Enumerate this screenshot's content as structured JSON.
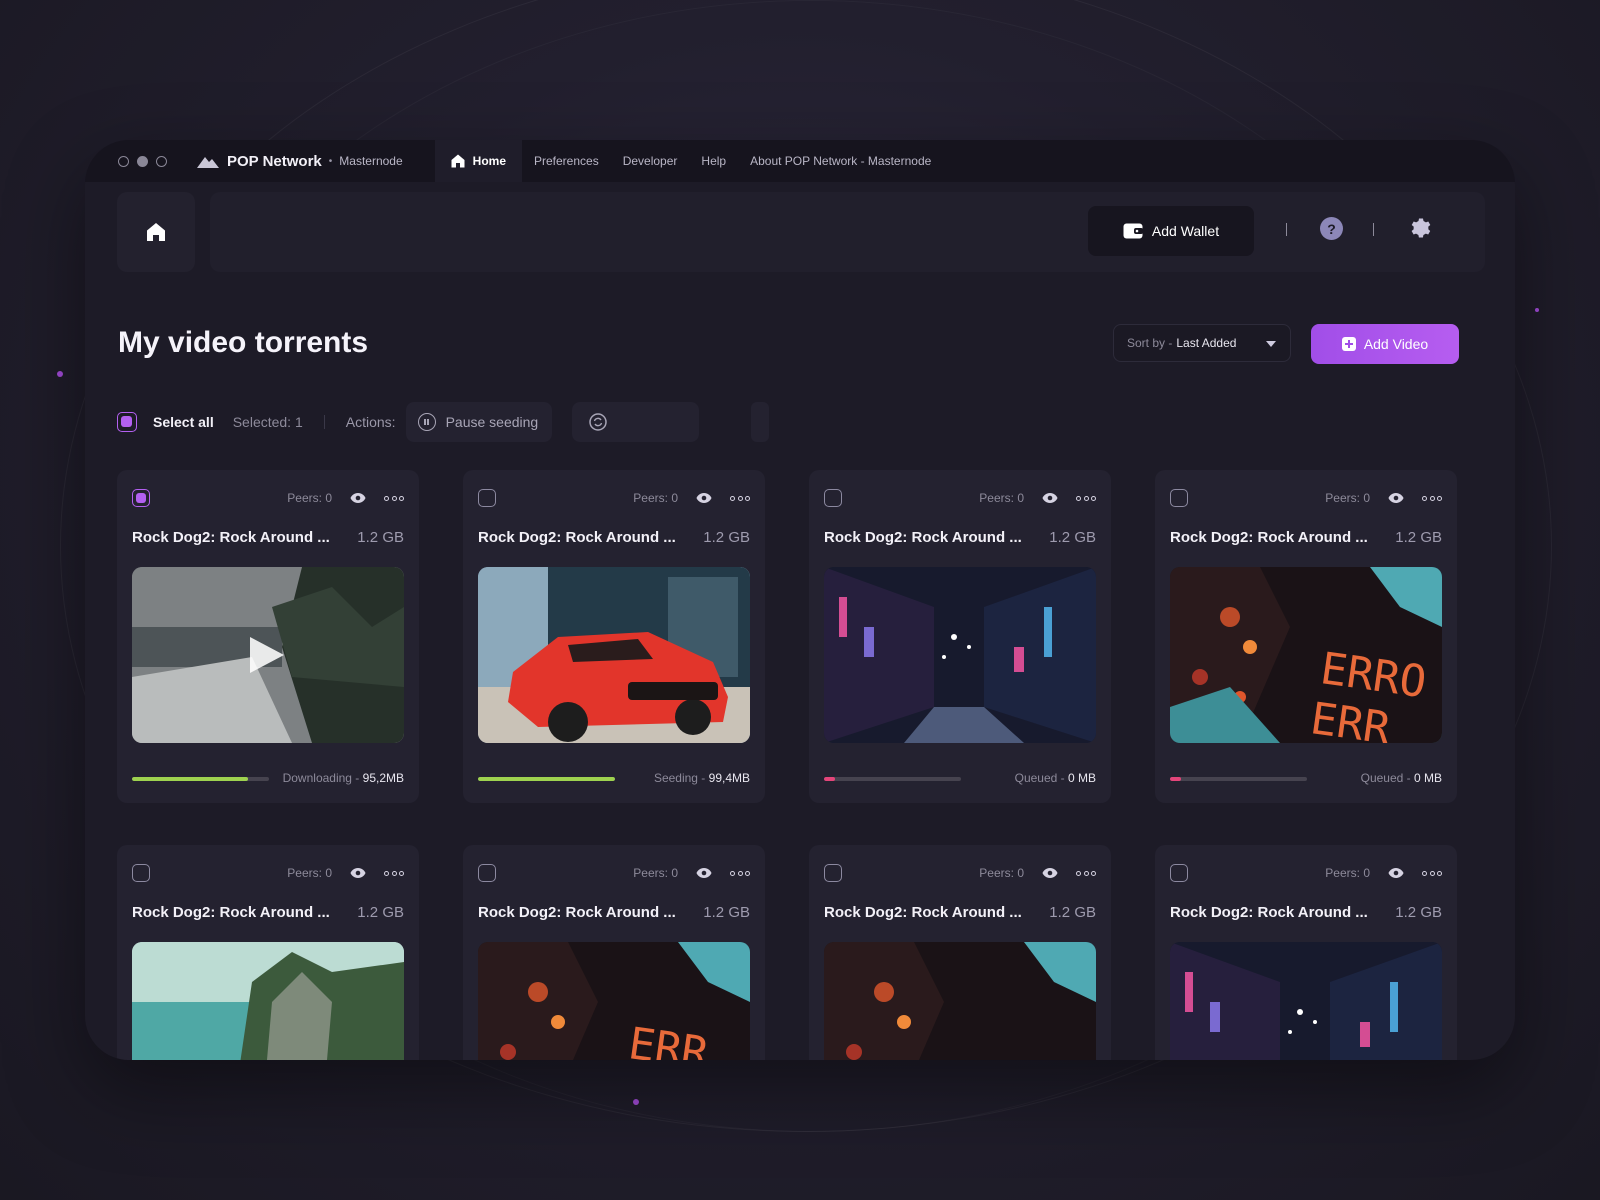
{
  "window_controls": [
    "close",
    "minimize",
    "maximize"
  ],
  "brand": {
    "name": "POP Network",
    "separator": "•",
    "subtitle": "Masternode"
  },
  "nav": [
    {
      "label": "Home",
      "active": true
    },
    {
      "label": "Preferences"
    },
    {
      "label": "Developer"
    },
    {
      "label": "Help"
    },
    {
      "label": "About POP Network - Masternode"
    }
  ],
  "header": {
    "add_wallet": "Add Wallet",
    "help_symbol": "?"
  },
  "page": {
    "title": "My video torrents",
    "sort_label": "Sort by - ",
    "sort_value": "Last Added",
    "add_video": "Add Video"
  },
  "actions": {
    "select_all": "Select all",
    "selected": "Selected: 1",
    "actions_label": "Actions:",
    "pause_seeding": "Pause seeding"
  },
  "colors": {
    "accent": "#b360f0",
    "progress_green": "#9ed24f",
    "progress_pink": "#e4457a"
  },
  "cards": [
    {
      "checked": true,
      "peers": "Peers: 0",
      "title": "Rock Dog2: Rock Around ...",
      "size": "1.2 GB",
      "thumb": "snow-forest",
      "progress": 0.85,
      "bar_color": "#9ed24f",
      "status_label": "Downloading - ",
      "status_value": "95,2MB",
      "play": true
    },
    {
      "checked": false,
      "peers": "Peers: 0",
      "title": "Rock Dog2: Rock Around ...",
      "size": "1.2 GB",
      "thumb": "red-car",
      "progress": 1.0,
      "bar_color": "#9ed24f",
      "status_label": "Seeding - ",
      "status_value": "99,4MB"
    },
    {
      "checked": false,
      "peers": "Peers: 0",
      "title": "Rock Dog2: Rock Around ...",
      "size": "1.2 GB",
      "thumb": "night-street",
      "progress": 0.08,
      "bar_color": "#e4457a",
      "status_label": "Queued - ",
      "status_value": "0 MB"
    },
    {
      "checked": false,
      "peers": "Peers: 0",
      "title": "Rock Dog2: Rock Around ...",
      "size": "1.2 GB",
      "thumb": "error-screen",
      "progress": 0.08,
      "bar_color": "#e4457a",
      "status_label": "Queued - ",
      "status_value": "0 MB",
      "thumb_text": "ERRO"
    },
    {
      "checked": false,
      "peers": "Peers: 0",
      "title": "Rock Dog2: Rock Around ...",
      "size": "1.2 GB",
      "thumb": "sea-cliff"
    },
    {
      "checked": false,
      "peers": "Peers: 0",
      "title": "Rock Dog2: Rock Around ...",
      "size": "1.2 GB",
      "thumb": "error-screen",
      "thumb_text": "ERR"
    },
    {
      "checked": false,
      "peers": "Peers: 0",
      "title": "Rock Dog2: Rock Around ...",
      "size": "1.2 GB",
      "thumb": "error-screen"
    },
    {
      "checked": false,
      "peers": "Peers: 0",
      "title": "Rock Dog2: Rock Around ...",
      "size": "1.2 GB",
      "thumb": "night-street"
    }
  ]
}
